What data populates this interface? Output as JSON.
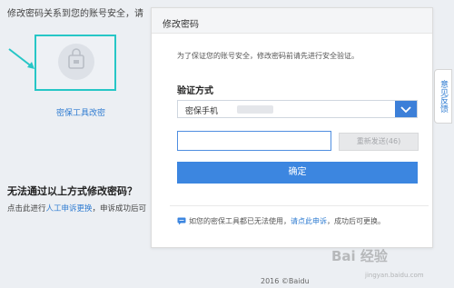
{
  "background": {
    "header_text": "修改密码关系到您的账号安全，请",
    "tool_link": "密保工具改密",
    "alt_heading": "无法通过以上方式修改密码？",
    "alt_text_before": "点击此进行",
    "alt_link": "人工申诉更换",
    "alt_text_after": "，申诉成功后可",
    "footer": "2016 ©Baidu",
    "side_tab": "意见反馈"
  },
  "modal": {
    "title": "修改密码",
    "intro": "为了保证您的账号安全，修改密码前请先进行安全验证。",
    "verify_label": "验证方式",
    "method_selected": "密保手机",
    "code_placeholder": "",
    "resend_label": "重新发送(46)",
    "confirm_label": "确定",
    "hint_before": "如您的密保工具都已无法使用，",
    "hint_link": "请点此申诉",
    "hint_after": "，成功后可更换。"
  },
  "watermark": {
    "text": "Bai 经验",
    "sub": "jingyan.baidu.com"
  },
  "colors": {
    "accent": "#3c86e0",
    "link": "#2e7bd1",
    "highlight": "#26c6c6"
  }
}
